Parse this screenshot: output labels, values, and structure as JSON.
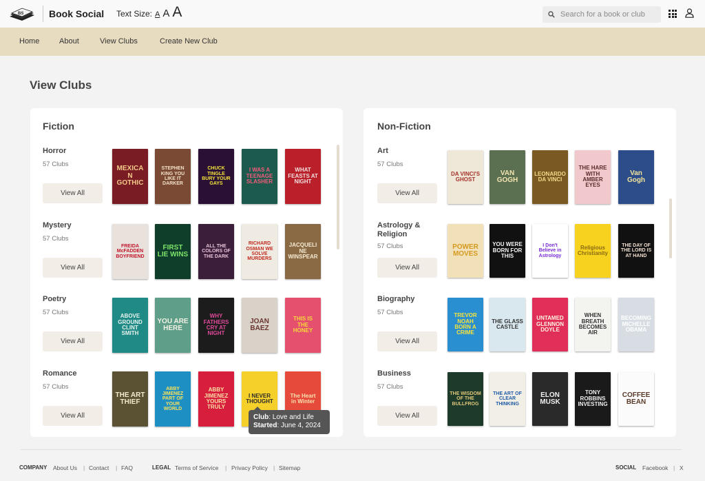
{
  "header": {
    "brand": "Book Social",
    "logo_text": "BS",
    "text_size_label": "Text Size:",
    "text_size_options": [
      "A",
      "A",
      "A"
    ],
    "search_placeholder": "Search for a book or club"
  },
  "nav": {
    "items": [
      "Home",
      "About",
      "View Clubs",
      "Create New Club"
    ]
  },
  "page_title": "View Clubs",
  "view_all_label": "View All",
  "panels": [
    {
      "title": "Fiction",
      "categories": [
        {
          "name": "Horror",
          "count": "57 Clubs",
          "books": [
            {
              "title": "MEXICAN GOTHIC",
              "bg": "#7a1c24",
              "fg": "#f3c98a"
            },
            {
              "title": "STEPHEN KING YOU LIKE IT DARKER",
              "bg": "#7a4a35",
              "fg": "#f1e2c8"
            },
            {
              "title": "CHUCK TINGLE BURY YOUR GAYS",
              "bg": "#2a1133",
              "fg": "#f5e23c"
            },
            {
              "title": "I WAS A TEENAGE SLASHER",
              "bg": "#1d5a4e",
              "fg": "#f25a7a"
            },
            {
              "title": "WHAT FEASTS AT NIGHT",
              "bg": "#b9202a",
              "fg": "#f2dede"
            }
          ]
        },
        {
          "name": "Mystery",
          "count": "57 Clubs",
          "books": [
            {
              "title": "FREIDA McFADDEN BOYFRIEND",
              "bg": "#e9e2dc",
              "fg": "#c2142b"
            },
            {
              "title": "FIRST LIE WINS",
              "bg": "#0f3f2a",
              "fg": "#7de36a"
            },
            {
              "title": "ALL THE COLORS OF THE DARK",
              "bg": "#3a1e3a",
              "fg": "#e7c3d8"
            },
            {
              "title": "RICHARD OSMAN WE SOLVE MURDERS",
              "bg": "#f0ebe2",
              "fg": "#c12a1e"
            },
            {
              "title": "JACQUELINE WINSPEAR",
              "bg": "#8a6a45",
              "fg": "#f5ead2"
            }
          ]
        },
        {
          "name": "Poetry",
          "count": "57 Clubs",
          "books": [
            {
              "title": "ABOVE GROUND CLINT SMITH",
              "bg": "#1f8a86",
              "fg": "#e8f3ee"
            },
            {
              "title": "YOU ARE HERE",
              "bg": "#5f9f8a",
              "fg": "#f1f1e4"
            },
            {
              "title": "WHY FATHERS CRY AT NIGHT",
              "bg": "#1c1c1c",
              "fg": "#e04a9a"
            },
            {
              "title": "JOAN BAEZ",
              "bg": "#d9d2c8",
              "fg": "#6a3530"
            },
            {
              "title": "THIS IS THE HONEY",
              "bg": "#e4506d",
              "fg": "#f7d83a"
            }
          ]
        },
        {
          "name": "Romance",
          "count": "57 Clubs",
          "books": [
            {
              "title": "THE ART THIEF",
              "bg": "#5a5232",
              "fg": "#f3e9cf"
            },
            {
              "title": "ABBY JIMENEZ PART OF YOUR WORLD",
              "bg": "#1e8fc2",
              "fg": "#fbe25a"
            },
            {
              "title": "ABBY JIMENEZ YOURS TRULY",
              "bg": "#d71e3d",
              "fg": "#fbe0a6"
            },
            {
              "title": "I NEVER THOUGHT",
              "bg": "#f6d02a",
              "fg": "#2a2a2a"
            },
            {
              "title": "The Heart in Winter",
              "bg": "#e64a3a",
              "fg": "#f7e1b1"
            }
          ]
        }
      ]
    },
    {
      "title": "Non-Fiction",
      "categories": [
        {
          "name": "Art",
          "count": "57 Clubs",
          "books": [
            {
              "title": "DA VINCI'S GHOST",
              "bg": "#efe7d7",
              "fg": "#a5332a"
            },
            {
              "title": "VAN GOGH",
              "bg": "#5b7050",
              "fg": "#f2e3b1"
            },
            {
              "title": "LEONARDO DA VINCI",
              "bg": "#7a5a22",
              "fg": "#f4d98a"
            },
            {
              "title": "THE HARE WITH AMBER EYES",
              "bg": "#f1c9cd",
              "fg": "#5a2a2a"
            },
            {
              "title": "Van Gogh",
              "bg": "#2d4d8a",
              "fg": "#f2e49a"
            }
          ]
        },
        {
          "name": "Astrology & Religion",
          "count": "57 Clubs",
          "books": [
            {
              "title": "POWER MOVES",
              "bg": "#f2e0b9",
              "fg": "#d49a1e"
            },
            {
              "title": "YOU WERE BORN FOR THIS",
              "bg": "#111111",
              "fg": "#f3f3f3"
            },
            {
              "title": "I Don't Believe in Astrology",
              "bg": "#ffffff",
              "fg": "#7a2ad4"
            },
            {
              "title": "Religious Christianity",
              "bg": "#f7d21e",
              "fg": "#8a6a12"
            },
            {
              "title": "THE DAY OF THE LORD IS AT HAND",
              "bg": "#111111",
              "fg": "#f0e0d0"
            }
          ]
        },
        {
          "name": "Biography",
          "count": "57 Clubs",
          "books": [
            {
              "title": "TREVOR NOAH BORN A CRIME",
              "bg": "#2a8fd0",
              "fg": "#fbe43a"
            },
            {
              "title": "THE GLASS CASTLE",
              "bg": "#d8e8ee",
              "fg": "#333333"
            },
            {
              "title": "UNTAMED GLENNON DOYLE",
              "bg": "#e0305a",
              "fg": "#fff3e0"
            },
            {
              "title": "WHEN BREATH BECOMES AIR",
              "bg": "#f3f3ef",
              "fg": "#333333"
            },
            {
              "title": "BECOMING MICHELLE OBAMA",
              "bg": "#d7dde3",
              "fg": "#ffffff"
            }
          ]
        },
        {
          "name": "Business",
          "count": "57 Clubs",
          "books": [
            {
              "title": "THE WISDOM OF THE BULLFROG",
              "bg": "#1d3a2a",
              "fg": "#e0c77a"
            },
            {
              "title": "THE ART OF CLEAR THINKING",
              "bg": "#f2efe6",
              "fg": "#1f5aa8"
            },
            {
              "title": "ELON MUSK",
              "bg": "#2a2a2a",
              "fg": "#f0f0f0"
            },
            {
              "title": "TONY ROBBINS INVESTING",
              "bg": "#1a1a1a",
              "fg": "#f0f0f0"
            },
            {
              "title": "COFFEE BEAN",
              "bg": "#fbfbfb",
              "fg": "#5a3a2a"
            }
          ]
        }
      ]
    }
  ],
  "tooltip": {
    "club_label": "Club",
    "club_value": "Love and Life",
    "started_label": "Started",
    "started_value": "June 4, 2024"
  },
  "footer": {
    "company_label": "COMPANY",
    "company_links": [
      "About Us",
      "Contact",
      "FAQ"
    ],
    "legal_label": "LEGAL",
    "legal_links": [
      "Terms of Service",
      "Privacy Policy",
      "Sitemap"
    ],
    "social_label": "SOCIAL",
    "social_links": [
      "Facebook",
      "X"
    ]
  }
}
